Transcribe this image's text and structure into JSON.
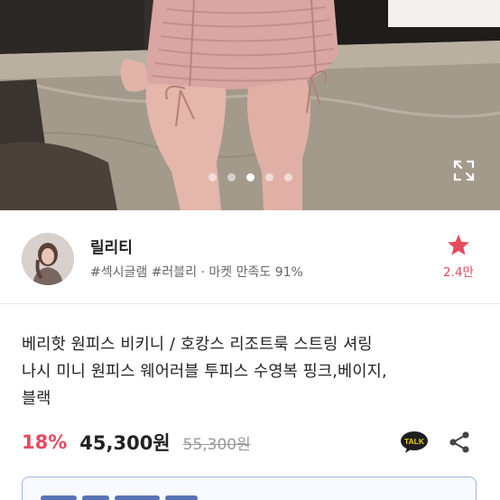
{
  "hero": {
    "slide_count": 5,
    "active_slide_index": 2,
    "expand_icon": "expand-icon"
  },
  "seller": {
    "name": "릴리티",
    "tags": "#섹시글램 #러블리 · 마켓 만족도 91%",
    "favorite_icon": "star-icon",
    "favorite_count": "2.4만",
    "accent_color": "#e84a5f"
  },
  "product": {
    "title_lines": [
      "베리핫 원피스 비키니 / 호캉스 리조트룩 스트링 셔링",
      "나시 미니 원피스 웨어러블 투피스 수영복 핑크,베이지,",
      "블랙"
    ],
    "discount": "18%",
    "price": "45,300원",
    "original_price": "55,300원"
  },
  "actions": {
    "talk_label": "TALK",
    "talk_icon": "kakaotalk-icon",
    "share_icon": "share-icon"
  }
}
